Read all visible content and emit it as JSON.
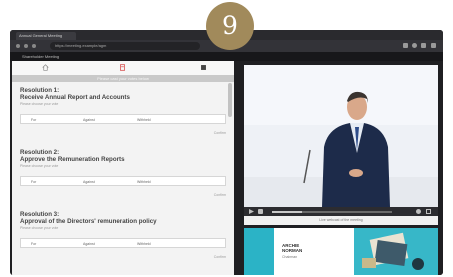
{
  "badge": {
    "number": "9"
  },
  "browser": {
    "tab_title": "Annual General Meeting",
    "url": "https://meeting.example/agm"
  },
  "app": {
    "title": "Shareholder Meeting"
  },
  "left_panel": {
    "banner": "Please cast your votes below",
    "resolutions": [
      {
        "title": "Resolution 1:",
        "name": "Receive Annual Report and Accounts",
        "subtitle": "Please choose your vote",
        "options": [
          "For",
          "Against",
          "Withheld"
        ],
        "confirm": "Confirm"
      },
      {
        "title": "Resolution 2:",
        "name": "Approve the Remuneration Reports",
        "subtitle": "Please choose your vote",
        "options": [
          "For",
          "Against",
          "Withheld"
        ],
        "confirm": "Confirm"
      },
      {
        "title": "Resolution 3:",
        "name": "Approval of the Directors' remuneration policy",
        "subtitle": "Please choose your vote",
        "options": [
          "For",
          "Against",
          "Withheld"
        ],
        "confirm": "Confirm"
      }
    ]
  },
  "right_panel": {
    "video_caption": "Live webcast of the meeting",
    "banner": {
      "name_line1": "ARCHIE",
      "name_line2": "NORMAN",
      "subtitle": "Chairman"
    }
  },
  "colors": {
    "accent_gold": "#a18a5b",
    "teal": "#2bb3c6",
    "dark_chrome": "#1f1f22"
  },
  "icons": [
    "home-icon",
    "document-icon",
    "vote-icon",
    "play-icon",
    "volume-icon",
    "settings-icon",
    "fullscreen-icon"
  ]
}
